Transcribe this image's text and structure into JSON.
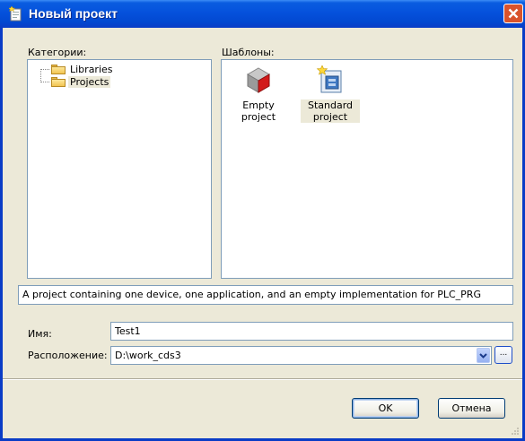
{
  "window": {
    "title": "Новый проект"
  },
  "categories": {
    "label": "Категории:",
    "items": [
      {
        "label": "Libraries",
        "selected": false
      },
      {
        "label": "Projects",
        "selected": true
      }
    ]
  },
  "templates": {
    "label": "Шаблоны:",
    "items": [
      {
        "label": "Empty project",
        "icon": "empty-project-icon",
        "selected": false
      },
      {
        "label": "Standard project",
        "icon": "standard-project-icon",
        "selected": true
      }
    ]
  },
  "description": "A project containing one device, one application, and an empty implementation for PLC_PRG",
  "name_field": {
    "label": "Имя:",
    "value": "Test1"
  },
  "location_field": {
    "label": "Расположение:",
    "value": "D:\\work_cds3",
    "browse_label": "..."
  },
  "buttons": {
    "ok": "OK",
    "cancel": "Отмена"
  },
  "colors": {
    "titlebar": "#0a5de0",
    "close": "#d9532c",
    "face": "#ece9d8"
  }
}
